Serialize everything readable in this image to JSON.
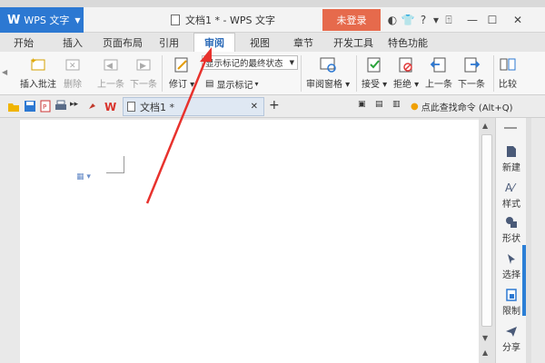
{
  "titlebar": {
    "app_name": "WPS 文字",
    "app_logo": "W",
    "document_title": "文档1 * - WPS 文字",
    "login_label": "未登录"
  },
  "tabs": [
    "开始",
    "插入",
    "页面布局",
    "引用",
    "审阅",
    "视图",
    "章节",
    "开发工具",
    "特色功能"
  ],
  "active_tab": "审阅",
  "ribbon": {
    "insert_comment": "插入批注",
    "delete": "删除",
    "prev_comment": "上一条",
    "next_comment": "下一条",
    "track_changes": "修订",
    "markup_mode": "显示标记的最终状态",
    "show_markup": "显示标记",
    "reviewing_pane": "审阅窗格",
    "accept": "接受",
    "reject": "拒绝",
    "prev_change": "上一条",
    "next_change": "下一条",
    "compare": "比较"
  },
  "quick_access": {
    "doc_tab": "文档1 *",
    "find_command": "点此查找命令 (Alt+Q)"
  },
  "sidebar": {
    "items": [
      "新建",
      "样式",
      "形状",
      "选择",
      "限制",
      "分享"
    ]
  },
  "colors": {
    "accent": "#2c78d2",
    "login": "#e66a4c",
    "arrow": "#e8322d"
  }
}
